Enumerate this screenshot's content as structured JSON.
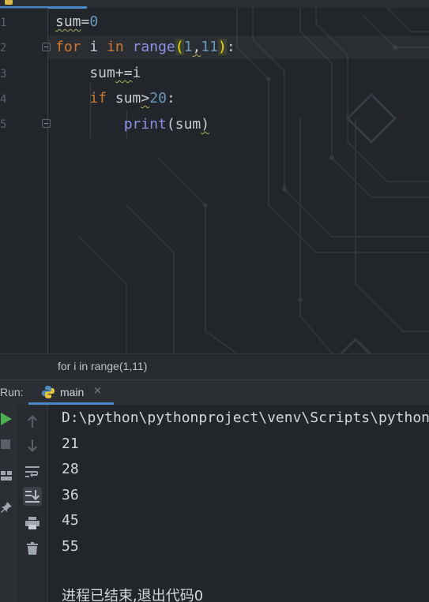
{
  "editor": {
    "line_numbers": [
      "1",
      "2",
      "3",
      "4",
      "5"
    ],
    "lines": [
      {
        "tokens": [
          {
            "t": "sum",
            "c": "plain squig"
          },
          {
            "t": "=",
            "c": "plain"
          },
          {
            "t": "0",
            "c": "num"
          }
        ]
      },
      {
        "tokens": [
          {
            "t": "for",
            "c": "kw"
          },
          {
            "t": " i ",
            "c": "plain"
          },
          {
            "t": "in",
            "c": "kw"
          },
          {
            "t": " ",
            "c": "plain"
          },
          {
            "t": "range",
            "c": "fn"
          },
          {
            "t": "(",
            "c": "paren-hl"
          },
          {
            "t": "1",
            "c": "num"
          },
          {
            "t": ",",
            "c": "plain squig"
          },
          {
            "t": "11",
            "c": "num"
          },
          {
            "t": ")",
            "c": "paren-hl"
          },
          {
            "t": ":",
            "c": "plain"
          }
        ]
      },
      {
        "tokens": [
          {
            "t": "    sum",
            "c": "plain"
          },
          {
            "t": "+=",
            "c": "plain squig"
          },
          {
            "t": "i",
            "c": "plain"
          }
        ]
      },
      {
        "tokens": [
          {
            "t": "    ",
            "c": "plain"
          },
          {
            "t": "if",
            "c": "kw"
          },
          {
            "t": " sum",
            "c": "plain"
          },
          {
            "t": ">",
            "c": "plain squig"
          },
          {
            "t": "20",
            "c": "num"
          },
          {
            "t": ":",
            "c": "plain"
          }
        ]
      },
      {
        "tokens": [
          {
            "t": "        ",
            "c": "plain"
          },
          {
            "t": "print",
            "c": "fn"
          },
          {
            "t": "(sum",
            "c": "plain"
          },
          {
            "t": ")",
            "c": "plain squig"
          }
        ]
      }
    ]
  },
  "breadcrumb": {
    "text": "for i in range(1,11)"
  },
  "run_panel": {
    "label": "Run:",
    "tab_label": "main",
    "close_glyph": "×",
    "output": [
      "D:\\python\\pythonproject\\venv\\Scripts\\python.exe",
      "21",
      "28",
      "36",
      "45",
      "55",
      "",
      "进程已结束,退出代码0"
    ]
  },
  "icons": {
    "run": "run-icon",
    "stop": "stop-icon",
    "layout": "layout-icon",
    "pin": "pin-icon",
    "up": "arrow-up-icon",
    "down": "arrow-down-icon",
    "wrap": "soft-wrap-icon",
    "scroll_end": "scroll-to-end-icon",
    "print": "print-icon",
    "trash": "trash-icon"
  },
  "colors": {
    "accent": "#4a88c7",
    "run_green": "#4caf50",
    "keyword": "#cc7832",
    "number": "#6897bb",
    "function": "#8b8fe6"
  }
}
